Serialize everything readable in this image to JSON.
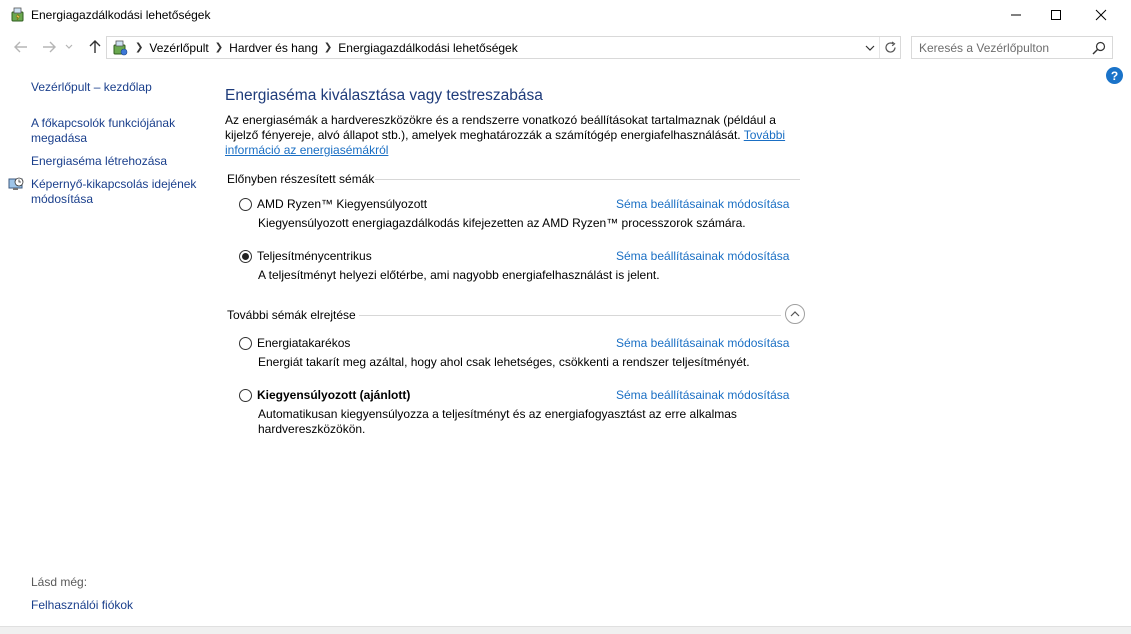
{
  "window": {
    "title": "Energiagazdálkodási lehetőségek"
  },
  "navigation": {
    "breadcrumbs": [
      "Vezérlőpult",
      "Hardver és hang",
      "Energiagazdálkodási lehetőségek"
    ],
    "search_placeholder": "Keresés a Vezérlőpulton"
  },
  "sidebar": {
    "items": [
      {
        "label": "Vezérlőpult – kezdőlap"
      },
      {
        "label": "A főkapcsolók funkciójának megadása"
      },
      {
        "label": "Energiaséma létrehozása"
      },
      {
        "label": "Képernyő-kikapcsolás idejének módosítása",
        "icon": "clock-monitor-icon"
      }
    ],
    "see_also_label": "Lásd még:",
    "see_also_items": [
      {
        "label": "Felhasználói fiókok"
      }
    ]
  },
  "main": {
    "heading": "Energiaséma kiválasztása vagy testreszabása",
    "intro_text": "Az energiasémák a hardvereszközökre és a rendszerre vonatkozó beállításokat tartalmaznak (például a kijelző fényereje, alvó állapot stb.), amelyek meghatározzák a számítógép energiafelhasználását. ",
    "intro_link": "További információ az energiasémákról",
    "preferred_header": "Előnyben részesített sémák",
    "hidden_header": "További sémák elrejtése",
    "change_link_label": "Séma beállításainak módosítása",
    "preferred_plans": [
      {
        "name": "AMD Ryzen™ Kiegyensúlyozott",
        "description": "Kiegyensúlyozott energiagazdálkodás kifejezetten az AMD Ryzen™ processzorok számára.",
        "selected": false
      },
      {
        "name": "Teljesítménycentrikus",
        "description": "A teljesítményt helyezi előtérbe, ami nagyobb energiafelhasználást is jelent.",
        "selected": true
      }
    ],
    "additional_plans": [
      {
        "name": "Energiatakarékos",
        "description": "Energiát takarít meg azáltal, hogy ahol csak lehetséges, csökkenti a rendszer teljesítményét.",
        "selected": false
      },
      {
        "name": "Kiegyensúlyozott (ajánlott)",
        "description": "Automatikusan kiegyensúlyozza a teljesítményt és az energiafogyasztást az erre alkalmas hardvereszközökön.",
        "selected": false
      }
    ]
  },
  "colors": {
    "link": "#1a6fc4",
    "heading": "#1e3b7a",
    "sidebar_link": "#1a3f8c",
    "help": "#1a73c9"
  }
}
